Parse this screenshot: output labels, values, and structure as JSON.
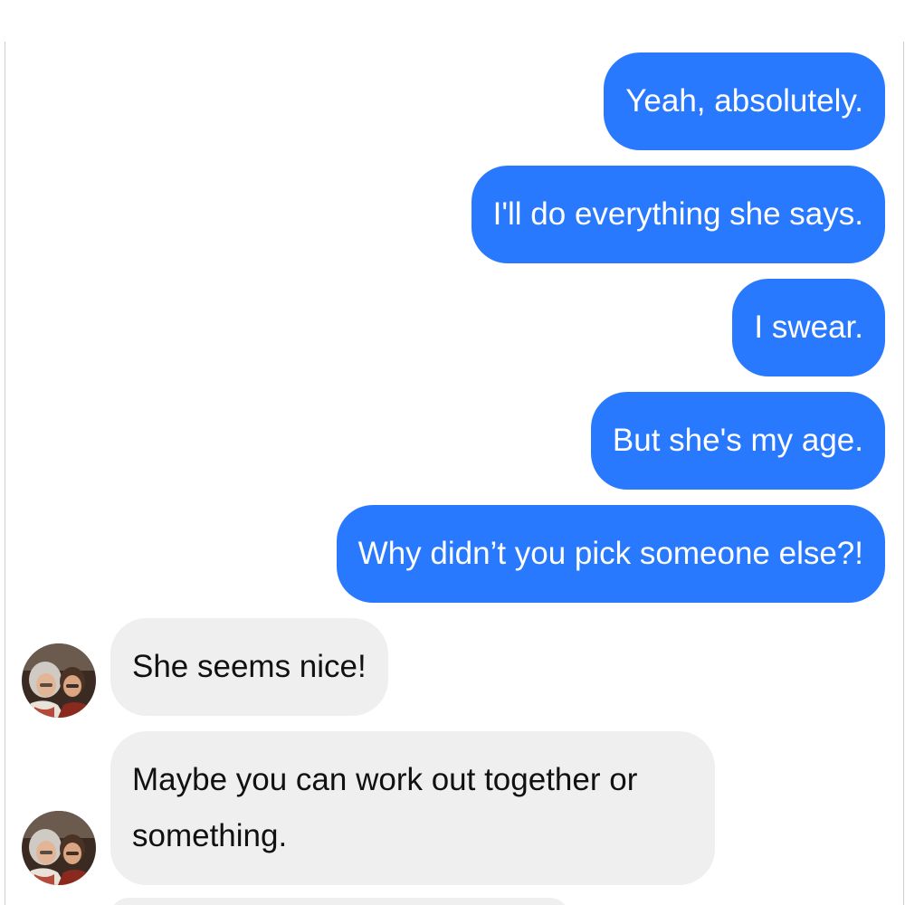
{
  "conversation": {
    "messages": [
      {
        "direction": "outgoing",
        "text": "Yeah, absolutely."
      },
      {
        "direction": "outgoing",
        "text": "I'll do everything she says."
      },
      {
        "direction": "outgoing",
        "text": "I swear."
      },
      {
        "direction": "outgoing",
        "text": "But she's my age."
      },
      {
        "direction": "outgoing",
        "text": "Why didn’t you pick someone else?!"
      },
      {
        "direction": "incoming",
        "text": "She seems nice!",
        "avatar_icon": "contact-photo-two-women"
      },
      {
        "direction": "incoming",
        "text": "Maybe you can work out together or something.",
        "avatar_icon": "contact-photo-two-women"
      }
    ]
  },
  "colors": {
    "outgoing_bubble": "#2979ff",
    "outgoing_text": "#ffffff",
    "incoming_bubble": "#efefef",
    "incoming_text": "#111111"
  }
}
